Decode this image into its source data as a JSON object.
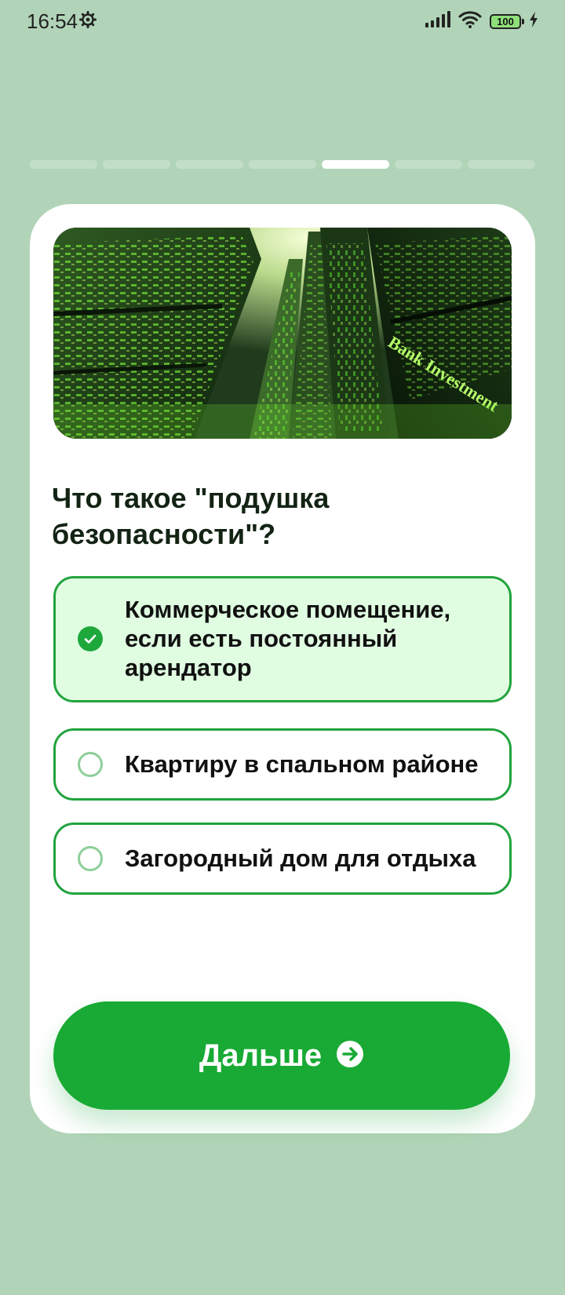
{
  "status_bar": {
    "time": "16:54",
    "battery": "100"
  },
  "progress": {
    "total_steps": 7,
    "current_step": 5
  },
  "question": {
    "title": "Что такое \"подушка безопасности\"?",
    "image_alt": "Green skyscrapers viewed from below",
    "hero_sign_text": "Bank Investment"
  },
  "options": [
    {
      "label": "Коммерческое помещение, если есть постоянный арендатор",
      "selected": true
    },
    {
      "label": "Квартиру в спальном районе",
      "selected": false
    },
    {
      "label": "Загородный дом для отдыха",
      "selected": false
    }
  ],
  "next_button": {
    "label": "Дальше",
    "icon": "arrow-right-circle-icon"
  },
  "colors": {
    "background": "#b1d4b8",
    "accent": "#18aa34",
    "selected_option_bg": "#e0fde2",
    "option_border": "#22a33e"
  }
}
